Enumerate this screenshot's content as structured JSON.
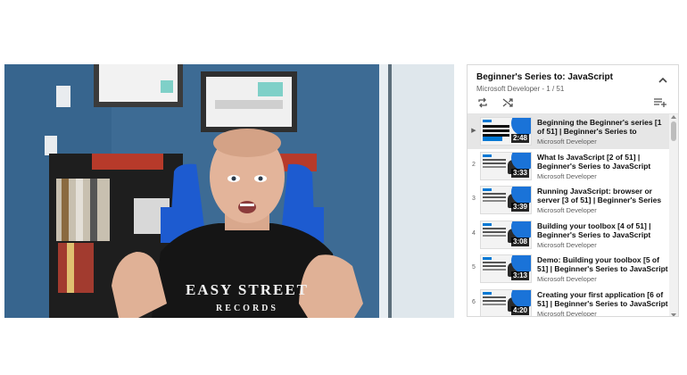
{
  "video": {
    "shirt_text_line1": "EASY STREET",
    "shirt_text_line2": "RECORDS"
  },
  "playlist": {
    "title": "Beginner's Series to: JavaScript",
    "channel": "Microsoft Developer",
    "position": "1 / 51",
    "icons": {
      "collapse": "chevron-up-icon",
      "loop": "loop-icon",
      "shuffle": "shuffle-icon",
      "save": "save-playlist-icon"
    },
    "items": [
      {
        "index": "▶",
        "title": "Beginning the Beginner's series [1 of 51] | Beginner's Series to JavaScript",
        "channel": "Microsoft Developer",
        "duration": "2:48",
        "active": true
      },
      {
        "index": "2",
        "title": "What Is JavaScript [2 of 51] | Beginner's Series to JavaScript",
        "channel": "Microsoft Developer",
        "duration": "3:33",
        "active": false
      },
      {
        "index": "3",
        "title": "Running JavaScript: browser or server [3 of 51] | Beginner's Series t...",
        "channel": "Microsoft Developer",
        "duration": "3:39",
        "active": false
      },
      {
        "index": "4",
        "title": "Building your toolbox [4 of 51] | Beginner's Series to JavaScript",
        "channel": "Microsoft Developer",
        "duration": "3:08",
        "active": false
      },
      {
        "index": "5",
        "title": "Demo: Building your toolbox [5 of 51] | Beginner's Series to JavaScript",
        "channel": "Microsoft Developer",
        "duration": "3:13",
        "active": false
      },
      {
        "index": "6",
        "title": "Creating your first application [6 of 51] | Beginner's Series to JavaScript",
        "channel": "Microsoft Developer",
        "duration": "4:20",
        "active": false
      }
    ]
  },
  "colors": {
    "wall": "#3c6a93",
    "accent": "#1a73d8",
    "active_row": "#e6e6e6"
  }
}
